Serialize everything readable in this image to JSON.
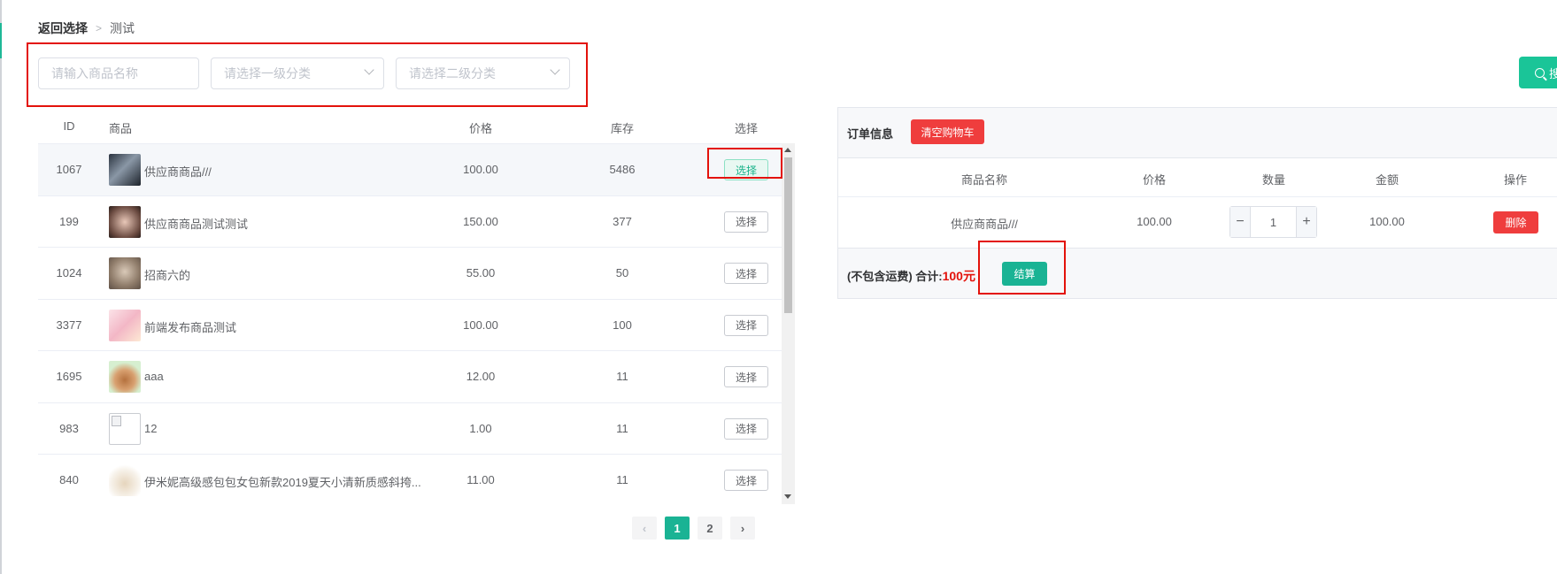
{
  "breadcrumb": {
    "back": "返回选择",
    "current": "测试"
  },
  "filters": {
    "name_placeholder": "请输入商品名称",
    "category1_placeholder": "请选择一级分类",
    "category2_placeholder": "请选择二级分类"
  },
  "search_button": "搜索",
  "product_table": {
    "columns": {
      "id": "ID",
      "product": "商品",
      "price": "价格",
      "stock": "库存",
      "select": "选择"
    },
    "rows": [
      {
        "id": "1067",
        "name": "供应商商品///",
        "price": "100.00",
        "stock": "5486",
        "action": "选择"
      },
      {
        "id": "199",
        "name": "供应商商品测试测试",
        "price": "150.00",
        "stock": "377",
        "action": "选择"
      },
      {
        "id": "1024",
        "name": "招商六的",
        "price": "55.00",
        "stock": "50",
        "action": "选择"
      },
      {
        "id": "3377",
        "name": "前端发布商品测试",
        "price": "100.00",
        "stock": "100",
        "action": "选择"
      },
      {
        "id": "1695",
        "name": "aaa",
        "price": "12.00",
        "stock": "11",
        "action": "选择"
      },
      {
        "id": "983",
        "name": "12",
        "price": "1.00",
        "stock": "11",
        "action": "选择"
      },
      {
        "id": "840",
        "name": "伊米妮高级感包包女包新款2019夏天小清新质感斜挎...",
        "price": "11.00",
        "stock": "11",
        "action": "选择"
      }
    ]
  },
  "pagination": {
    "prev": "‹",
    "pages": [
      "1",
      "2"
    ],
    "current": "1",
    "next": "›"
  },
  "order": {
    "title": "订单信息",
    "clear_button": "清空购物车",
    "columns": {
      "name": "商品名称",
      "price": "价格",
      "qty": "数量",
      "amount": "金额",
      "ops": "操作"
    },
    "rows": [
      {
        "name": "供应商商品///",
        "price": "100.00",
        "qty": "1",
        "amount": "100.00",
        "delete": "删除",
        "minus": "−",
        "plus": "+"
      }
    ],
    "footer": {
      "note": "(不包含运费) 合计:",
      "total": "100",
      "unit": "元",
      "checkout": "结算"
    }
  },
  "colors": {
    "accent": "#1ab394",
    "danger": "#ef3d3d",
    "highlight": "#e3120b"
  }
}
